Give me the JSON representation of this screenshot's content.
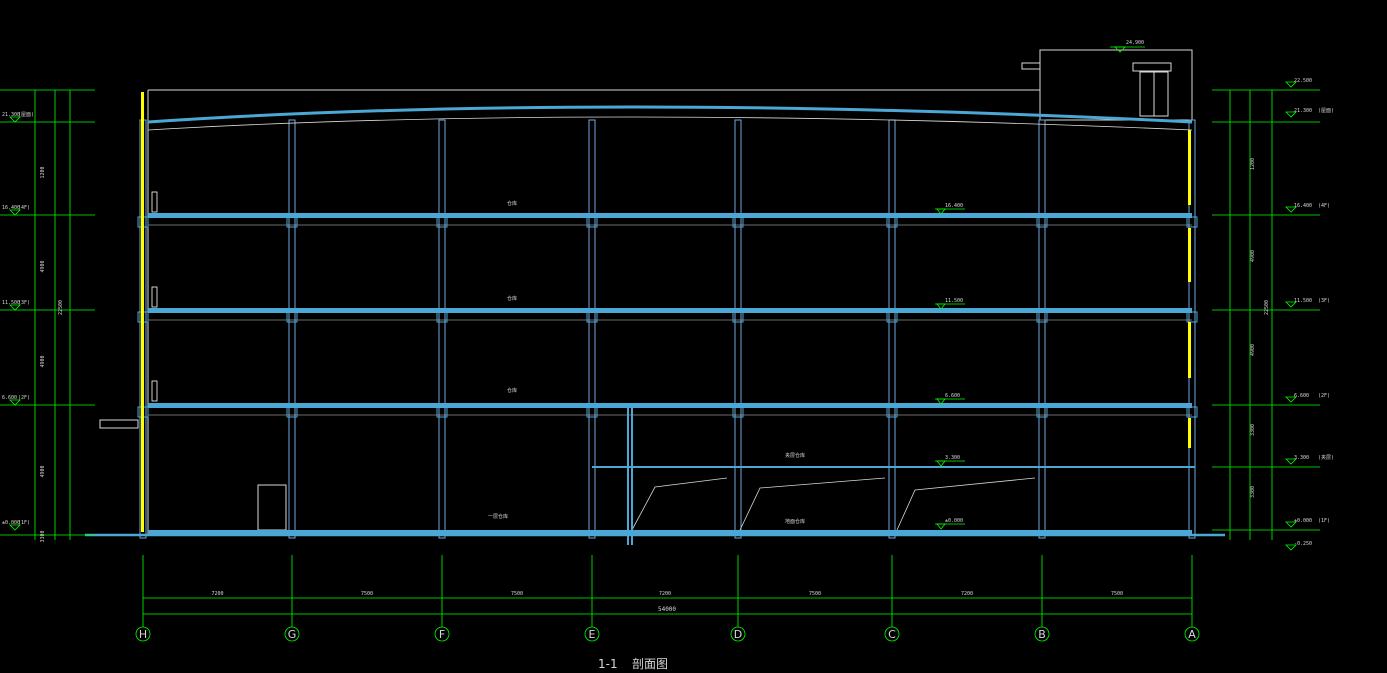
{
  "drawing": {
    "title_code": "1-1",
    "title_name": "剖面图",
    "total_width": "54000",
    "bays": [
      "7200",
      "7500",
      "7500",
      "7200",
      "7500",
      "7200",
      "7500"
    ],
    "axes": [
      "H",
      "G",
      "F",
      "E",
      "D",
      "C",
      "B",
      "A"
    ],
    "floor_elev_right": [
      "22.500",
      "21.300",
      "16.400",
      "11.500",
      "6.600",
      "3.300",
      "±0.000",
      "-0.250"
    ],
    "floor_tags_right": [
      "(屋面)",
      "(4F)",
      "(3F)",
      "(2F)",
      "(夹层)",
      "(1F)"
    ],
    "floor_elev_left": [
      "21.300",
      "16.400",
      "11.500",
      "6.600",
      "±0.000"
    ],
    "floor_tags_left": [
      "(屋面)",
      "(4F)",
      "(3F)",
      "(2F)",
      "(1F)"
    ],
    "inner_elev": [
      "16.400",
      "11.500",
      "6.600",
      "3.300",
      "±0.000"
    ],
    "room_labels": [
      "仓库",
      "仓库",
      "仓库",
      "一层仓库",
      "夹层仓库",
      "地面仓库"
    ],
    "top_elev": "24.900",
    "height_total": "22500",
    "dims_right": [
      "1200",
      "4900",
      "4900",
      "3300",
      "3300"
    ],
    "dims_left": [
      "1200",
      "4900",
      "4900",
      "4900",
      "3300"
    ],
    "colors": {
      "background": "#000000",
      "slab": "#4aa7d6",
      "dim": "#00ff00",
      "line": "#d8d8d8",
      "window": "#ffff00",
      "column": "#6fa8dc"
    }
  }
}
